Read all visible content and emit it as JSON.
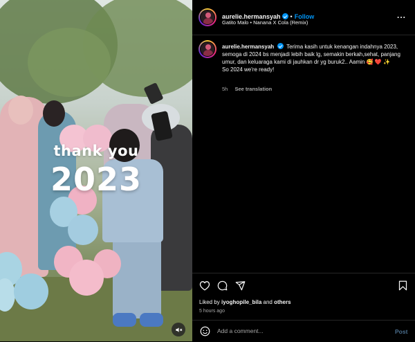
{
  "post": {
    "username": "aurelie.hermansyah",
    "follow_label": "Follow",
    "separator": "•",
    "audio": "Gatito Malo • Nanana X Cola (Remix)",
    "more_label": "...",
    "overlay": {
      "line1": "thank you",
      "line2": "2023"
    }
  },
  "caption": {
    "username": "aurelie.hermansyah",
    "text_line1": "Terima kasih untuk kenangan indahnya 2023, semoga di 2024 bs menjadi lebih baik lg, semakin berkah,sehat, panjang umur, dan keluaraga kami di jauhkan dr yg buruk2.. Aamin",
    "emoji": "🥰 ❤️ ✨",
    "text_line2": "So 2024 we're ready!",
    "age": "5h",
    "see_translation": "See translation"
  },
  "engagement": {
    "liked_prefix": "Liked by",
    "liked_user": "iyoghopile_bila",
    "liked_and": "and",
    "liked_others": "others",
    "time_ago": "5 hours ago"
  },
  "comment": {
    "placeholder": "Add a comment...",
    "post_label": "Post"
  },
  "colors": {
    "link_blue": "#0095f6",
    "post_button_disabled": "#4a6d8c",
    "divider": "#262626"
  },
  "icons": [
    "heart-icon",
    "comment-icon",
    "share-icon",
    "bookmark-icon",
    "emoji-icon",
    "mute-icon",
    "more-icon",
    "verified-icon"
  ]
}
